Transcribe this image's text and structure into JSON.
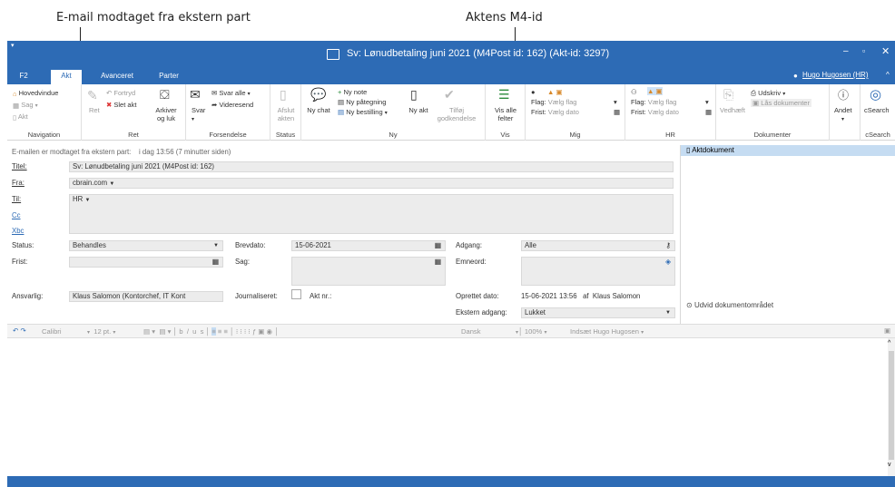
{
  "callouts": {
    "left": "E-mail modtaget fra ekstern part",
    "right": "Aktens M4-id"
  },
  "window": {
    "title": "Sv: Lønudbetaling juni 2021 (M4Post id: 162) (Akt-id: 3297)",
    "user": "Hugo Hugosen (HR)",
    "accent": "#2d6bb5"
  },
  "tabs": [
    "F2",
    "Akt",
    "Avanceret",
    "Parter"
  ],
  "ribbon": {
    "navigation": {
      "label": "Navigation",
      "hovedvindue": "Hovedvindue",
      "sag": "Sag",
      "akt": "Akt"
    },
    "ret": {
      "label": "Ret",
      "fortryd": "Fortryd",
      "slet_akt": "Slet akt",
      "ret": "Ret",
      "arkiver": "Arkiver og luk"
    },
    "forsendelse": {
      "label": "Forsendelse",
      "svar": "Svar",
      "svar_alle": "Svar alle",
      "videresend": "Videresend"
    },
    "status": {
      "label": "Status",
      "afslut": "Afslut akten"
    },
    "ny": {
      "label": "Ny",
      "ny_chat": "Ny chat",
      "ny_note": "Ny note",
      "ny_paategning": "Ny påtegning",
      "ny_bestilling": "Ny bestilling",
      "ny_akt": "Ny akt",
      "tilfoej": "Tilføj godkendelse"
    },
    "vis": {
      "label": "Vis",
      "vis_alle": "Vis alle felter"
    },
    "mig": {
      "label": "Mig",
      "flag": "Flag:",
      "flag_val": "Vælg flag",
      "frist": "Frist:",
      "frist_val": "Vælg dato"
    },
    "hr": {
      "label": "HR",
      "flag": "Flag:",
      "flag_val": "Vælg flag",
      "frist": "Frist:",
      "frist_val": "Vælg dato"
    },
    "dokumenter": {
      "label": "Dokumenter",
      "vedhaeft": "Vedhæft",
      "udskriv": "Udskriv",
      "laas": "Lås dokumenter"
    },
    "andet": {
      "label": "Andet"
    },
    "csearch": {
      "label": "cSearch",
      "btn": "cSearch"
    }
  },
  "notice": {
    "text": "E-mailen er modtaget fra ekstern part:",
    "time": "i dag 13:56 (7 minutter siden)"
  },
  "form": {
    "titel_label": "Titel:",
    "titel": "Sv: Lønudbetaling juni 2021 (M4Post id: 162)",
    "fra_label": "Fra:",
    "fra": "cbrain.com",
    "til_label": "Til:",
    "til": "HR",
    "cc_label": "Cc",
    "bcc_label": "Xbc",
    "status_label": "Status:",
    "status": "Behandles",
    "frist_label": "Frist:",
    "ansvarlig_label": "Ansvarlig:",
    "ansvarlig": "Klaus Salomon (Kontorchef, IT Kont",
    "brevdato_label": "Brevdato:",
    "brevdato": "15-06-2021",
    "sag_label": "Sag:",
    "journaliseret_label": "Journaliseret:",
    "aktnr_label": "Akt nr.:",
    "adgang_label": "Adgang:",
    "adgang": "Alle",
    "emneord_label": "Emneord:",
    "oprettet_label": "Oprettet dato:",
    "oprettet": "15-06-2021 13:56",
    "af": "af",
    "oprettet_af": "Klaus Salomon",
    "ekstern_label": "Ekstern adgang:",
    "ekstern": "Lukket"
  },
  "side": {
    "aktdokument": "Aktdokument",
    "udvid": "Udvid dokumentområdet"
  },
  "editor_toolbar": {
    "font": "Calibri",
    "size": "12 pt.",
    "lang": "Dansk",
    "zoom": "100%",
    "indsaet": "Indsæt Hugo Hugosen"
  },
  "statusbar": {
    "left": "",
    "right": ""
  }
}
